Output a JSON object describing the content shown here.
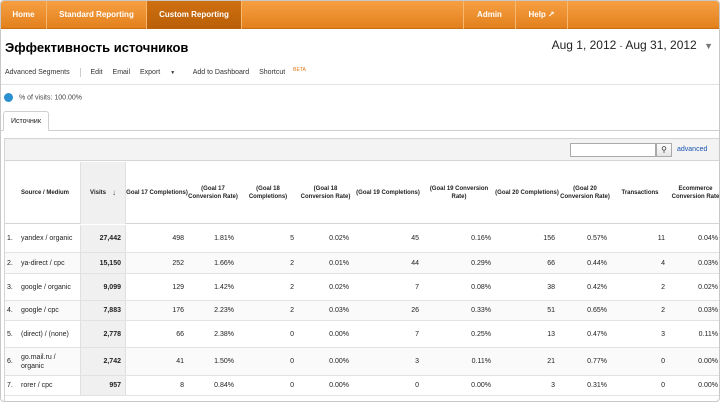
{
  "nav": {
    "items": [
      {
        "label": "Home",
        "active": false
      },
      {
        "label": "Standard Reporting",
        "active": false
      },
      {
        "label": "Custom Reporting",
        "active": true
      },
      {
        "label": "Admin",
        "active": false
      },
      {
        "label": "Help",
        "active": false
      }
    ],
    "help_icon": "external-link-icon"
  },
  "report": {
    "title": "Эффективность источников",
    "date_start": "Aug 1, 2012",
    "date_sep": "-",
    "date_end": "Aug 31, 2012"
  },
  "toolbar": {
    "segments": "Advanced Segments",
    "edit": "Edit",
    "email": "Email",
    "export": "Export",
    "add_dashboard": "Add to Dashboard",
    "shortcut": "Shortcut",
    "beta": "BETA"
  },
  "segment": {
    "text": "% of visits: 100.00%",
    "color": "#2b8fd0"
  },
  "tabs": [
    {
      "label": "Источник"
    }
  ],
  "search": {
    "placeholder": "",
    "advanced": "advanced"
  },
  "table": {
    "headers": {
      "source": "Source / Medium",
      "visits": "Visits",
      "g17c": "Goal 17 Completions)",
      "g17r": "(Goal 17 Conversion Rate)",
      "g18c": "(Goal 18 Completions)",
      "g18r": "(Goal 18 Conversion Rate)",
      "g19c": "(Goal 19 Completions)",
      "g19r": "(Goal 19 Conversion Rate)",
      "g20c": "(Goal 20 Completions)",
      "g20r": "(Goal 20 Conversion Rate)",
      "trans": "Transactions",
      "ecom": "Ecommerce Conversion Rate"
    },
    "rows": [
      {
        "idx": "1.",
        "src": "yandex / organic",
        "visits": "27,442",
        "g17c": "498",
        "g17r": "1.81%",
        "g18c": "5",
        "g18r": "0.02%",
        "g19c": "45",
        "g19r": "0.16%",
        "g20c": "156",
        "g20r": "0.57%",
        "trans": "11",
        "ecom": "0.04%"
      },
      {
        "idx": "2.",
        "src": "ya-direct / cpc",
        "visits": "15,150",
        "g17c": "252",
        "g17r": "1.66%",
        "g18c": "2",
        "g18r": "0.01%",
        "g19c": "44",
        "g19r": "0.29%",
        "g20c": "66",
        "g20r": "0.44%",
        "trans": "4",
        "ecom": "0.03%"
      },
      {
        "idx": "3.",
        "src": "google / organic",
        "visits": "9,099",
        "g17c": "129",
        "g17r": "1.42%",
        "g18c": "2",
        "g18r": "0.02%",
        "g19c": "7",
        "g19r": "0.08%",
        "g20c": "38",
        "g20r": "0.42%",
        "trans": "2",
        "ecom": "0.02%"
      },
      {
        "idx": "4.",
        "src": "google / cpc",
        "visits": "7,883",
        "g17c": "176",
        "g17r": "2.23%",
        "g18c": "2",
        "g18r": "0.03%",
        "g19c": "26",
        "g19r": "0.33%",
        "g20c": "51",
        "g20r": "0.65%",
        "trans": "2",
        "ecom": "0.03%"
      },
      {
        "idx": "5.",
        "src": "(direct) / (none)",
        "visits": "2,778",
        "g17c": "66",
        "g17r": "2.38%",
        "g18c": "0",
        "g18r": "0.00%",
        "g19c": "7",
        "g19r": "0.25%",
        "g20c": "13",
        "g20r": "0.47%",
        "trans": "3",
        "ecom": "0.11%"
      },
      {
        "idx": "6.",
        "src": "go.mail.ru / organic",
        "visits": "2,742",
        "g17c": "41",
        "g17r": "1.50%",
        "g18c": "0",
        "g18r": "0.00%",
        "g19c": "3",
        "g19r": "0.11%",
        "g20c": "21",
        "g20r": "0.77%",
        "trans": "0",
        "ecom": "0.00%"
      },
      {
        "idx": "7.",
        "src": "rorer / cpc",
        "visits": "957",
        "g17c": "8",
        "g17r": "0.84%",
        "g18c": "0",
        "g18r": "0.00%",
        "g19c": "0",
        "g19r": "0.00%",
        "g20c": "3",
        "g20r": "0.31%",
        "trans": "0",
        "ecom": "0.00%"
      }
    ]
  }
}
